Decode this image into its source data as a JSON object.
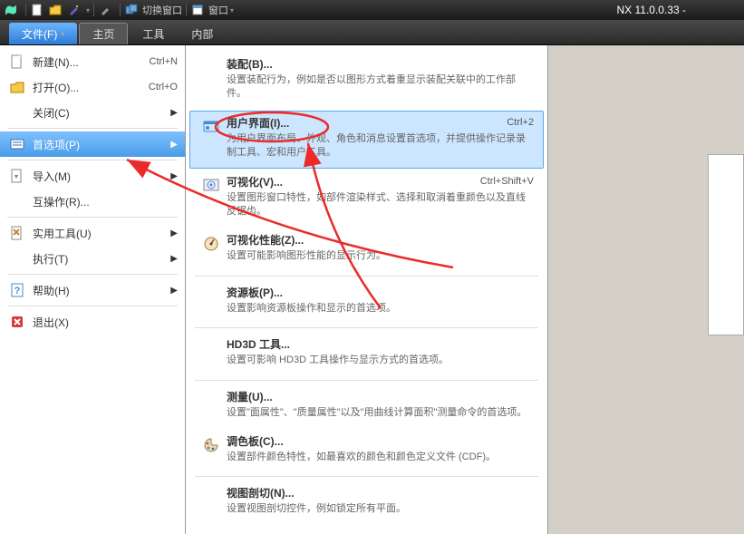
{
  "app": {
    "title": "NX 11.0.0.33 -"
  },
  "toolbar": {
    "switch_window": "切换窗口",
    "window": "窗口"
  },
  "tabs": {
    "file": "文件(F)",
    "home": "主页",
    "tools": "工具",
    "internal": "内部"
  },
  "filemenu": {
    "new": {
      "label": "新建(N)...",
      "shortcut": "Ctrl+N"
    },
    "open": {
      "label": "打开(O)...",
      "shortcut": "Ctrl+O"
    },
    "close": {
      "label": "关闭(C)"
    },
    "preferences": {
      "label": "首选项(P)"
    },
    "import": {
      "label": "导入(M)"
    },
    "interop": {
      "label": "互操作(R)..."
    },
    "utilities": {
      "label": "实用工具(U)"
    },
    "execute": {
      "label": "执行(T)"
    },
    "help": {
      "label": "帮助(H)"
    },
    "exit": {
      "label": "退出(X)"
    }
  },
  "submenu": {
    "assembly": {
      "title": "装配(B)...",
      "desc": "设置装配行为，例如是否以图形方式着重显示装配关联中的工作部件。"
    },
    "ui": {
      "title": "用户界面(I)...",
      "shortcut": "Ctrl+2",
      "desc": "为用户界面布局、外观、角色和消息设置首选项，并提供操作记录录制工具、宏和用户工具。"
    },
    "visual": {
      "title": "可视化(V)...",
      "shortcut": "Ctrl+Shift+V",
      "desc": "设置图形窗口特性，如部件渲染样式、选择和取消着重颜色以及直线反锯齿。"
    },
    "visualperf": {
      "title": "可视化性能(Z)...",
      "desc": "设置可能影响图形性能的显示行为。"
    },
    "resource": {
      "title": "资源板(P)...",
      "desc": "设置影响资源板操作和显示的首选项。"
    },
    "hd3d": {
      "title": "HD3D 工具...",
      "desc": "设置可影响 HD3D 工具操作与显示方式的首选项。"
    },
    "measure": {
      "title": "测量(U)...",
      "desc": "设置\"面属性\"、\"质量属性\"以及\"用曲线计算面积\"测量命令的首选项。"
    },
    "palette": {
      "title": "调色板(C)...",
      "desc": "设置部件颜色特性，如最喜欢的颜色和颜色定义文件 (CDF)。"
    },
    "section": {
      "title": "视图剖切(N)...",
      "desc": "设置视图剖切控件，例如锁定所有平面。"
    }
  }
}
